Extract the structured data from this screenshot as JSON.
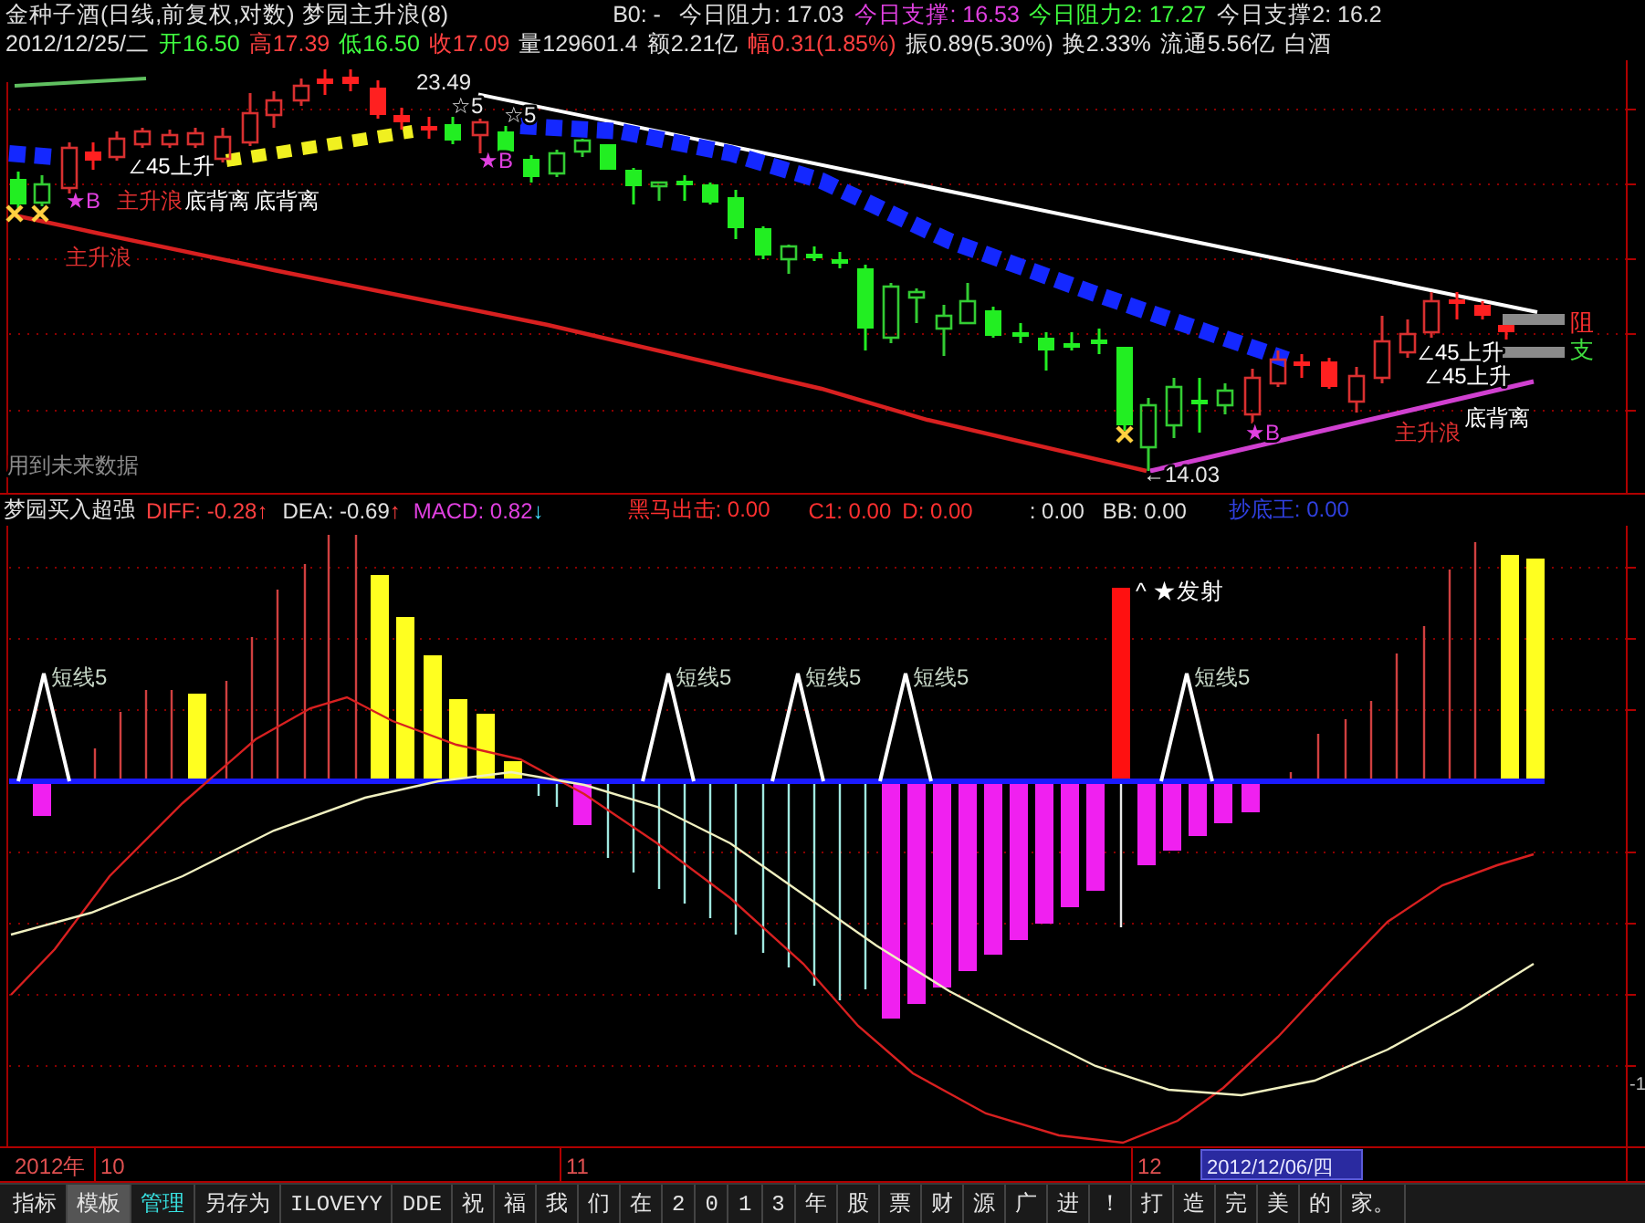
{
  "header": {
    "title": "金种子酒(日线,前复权,对数)",
    "indicator": "梦园主升浪(8)",
    "readouts": [
      {
        "text": "B0: -",
        "color": "#e0e0e0"
      },
      {
        "text": "今日阻力: 17.03",
        "color": "#e0e0e0"
      },
      {
        "text": "今日支撑: 16.53",
        "color": "#e040e0"
      },
      {
        "text": "今日阻力2: 17.27",
        "color": "#40ff40"
      },
      {
        "text": "今日支撑2: 16.2",
        "color": "#e0e0e0"
      }
    ]
  },
  "quote": {
    "date": "2012/12/25/二",
    "fields": [
      {
        "text": "开16.50",
        "color": "#40ff40"
      },
      {
        "text": "高17.39",
        "color": "#ff4040"
      },
      {
        "text": "低16.50",
        "color": "#40ff40"
      },
      {
        "text": "收17.09",
        "color": "#ff4040"
      },
      {
        "text": "量129601.4",
        "color": "#e0e0e0"
      },
      {
        "text": "额2.21亿",
        "color": "#e0e0e0"
      },
      {
        "text": "幅0.31(1.85%)",
        "color": "#ff4040"
      },
      {
        "text": "振0.89(5.30%)",
        "color": "#e0e0e0"
      },
      {
        "text": "换2.33%",
        "color": "#e0e0e0"
      },
      {
        "text": "流通5.56亿",
        "color": "#e0e0e0"
      },
      {
        "text": "白酒",
        "color": "#e0e0e0"
      }
    ]
  },
  "price_chart": {
    "labels": [
      {
        "text": "23.49",
        "kind": "price"
      },
      {
        "text": "☆5",
        "kind": "star"
      },
      {
        "text": "☆5",
        "kind": "star"
      },
      {
        "text": "★B",
        "kind": "buy"
      },
      {
        "text": "∠45上升",
        "kind": "rise"
      },
      {
        "text": "★B",
        "kind": "buy"
      },
      {
        "text": "主升浪",
        "kind": "wave"
      },
      {
        "text": "底背离",
        "kind": "divergence"
      },
      {
        "text": "底背离",
        "kind": "divergence"
      },
      {
        "text": "主升浪",
        "kind": "wave"
      },
      {
        "text": "★B",
        "kind": "buy"
      },
      {
        "text": "←14.03",
        "kind": "price"
      },
      {
        "text": "∠45上升",
        "kind": "rise"
      },
      {
        "text": "∠45上升",
        "kind": "rise"
      },
      {
        "text": "主升浪",
        "kind": "wave"
      },
      {
        "text": "底背离",
        "kind": "divergence"
      },
      {
        "text": "阻",
        "kind": "resistance"
      },
      {
        "text": "支",
        "kind": "support"
      },
      {
        "text": "用到未来数据",
        "kind": "note"
      }
    ]
  },
  "indicator": {
    "title": "梦园买入超强",
    "readouts": [
      {
        "text": "DIFF: -0.28",
        "color": "#ff4040",
        "arrow": {
          "text": "↑",
          "color": "#ff4040"
        }
      },
      {
        "text": "DEA: -0.69",
        "color": "#e0e0e0",
        "arrow": {
          "text": "↑",
          "color": "#ff4040"
        }
      },
      {
        "text": "MACD: 0.82",
        "color": "#e040e0",
        "arrow": {
          "text": "↓",
          "color": "#40e0ff"
        }
      },
      {
        "text": "黑马出击: 0.00",
        "color": "#ff3030"
      },
      {
        "text": "C1: 0.00",
        "color": "#ff3030"
      },
      {
        "text": "D: 0.00",
        "color": "#ff3030"
      },
      {
        "text": ": 0.00",
        "color": "#e0e0e0"
      },
      {
        "text": "BB: 0.00",
        "color": "#e0e0e0"
      },
      {
        "text": "抄底王: 0.00",
        "color": "#3040e0"
      }
    ],
    "labels": [
      {
        "text": "短线5",
        "kind": "short"
      },
      {
        "text": "短线5",
        "kind": "short"
      },
      {
        "text": "短线5",
        "kind": "short"
      },
      {
        "text": "短线5",
        "kind": "short"
      },
      {
        "text": "^ ★发射",
        "kind": "launch"
      },
      {
        "text": "短线5",
        "kind": "short"
      }
    ],
    "axis_label": "-1"
  },
  "date_axis": {
    "year": "2012年",
    "months": [
      "10",
      "11",
      "12"
    ],
    "cursor_date": "2012/12/06/四"
  },
  "toolbar": {
    "tabs": [
      {
        "label": "指标",
        "selected": false,
        "kind": "plain"
      },
      {
        "label": "模板",
        "selected": true,
        "kind": "plain"
      },
      {
        "label": "管理",
        "selected": false,
        "kind": "accent"
      },
      {
        "label": "另存为",
        "selected": false,
        "kind": "plain"
      },
      {
        "label": "ILOVEYY",
        "selected": false,
        "kind": "plain"
      },
      {
        "label": "DDE",
        "selected": false,
        "kind": "plain"
      },
      {
        "label": "祝",
        "selected": false,
        "kind": "plain"
      },
      {
        "label": "福",
        "selected": false,
        "kind": "plain"
      },
      {
        "label": "我",
        "selected": false,
        "kind": "plain"
      },
      {
        "label": "们",
        "selected": false,
        "kind": "plain"
      },
      {
        "label": "在",
        "selected": false,
        "kind": "plain"
      },
      {
        "label": "2",
        "selected": false,
        "kind": "plain"
      },
      {
        "label": "0",
        "selected": false,
        "kind": "plain"
      },
      {
        "label": "1",
        "selected": false,
        "kind": "plain"
      },
      {
        "label": "3",
        "selected": false,
        "kind": "plain"
      },
      {
        "label": "年",
        "selected": false,
        "kind": "plain"
      },
      {
        "label": "股",
        "selected": false,
        "kind": "plain"
      },
      {
        "label": "票",
        "selected": false,
        "kind": "plain"
      },
      {
        "label": "财",
        "selected": false,
        "kind": "plain"
      },
      {
        "label": "源",
        "selected": false,
        "kind": "plain"
      },
      {
        "label": "广",
        "selected": false,
        "kind": "plain"
      },
      {
        "label": "进",
        "selected": false,
        "kind": "plain"
      },
      {
        "label": "！",
        "selected": false,
        "kind": "plain"
      },
      {
        "label": "打",
        "selected": false,
        "kind": "plain"
      },
      {
        "label": "造",
        "selected": false,
        "kind": "plain"
      },
      {
        "label": "完",
        "selected": false,
        "kind": "plain"
      },
      {
        "label": "美",
        "selected": false,
        "kind": "plain"
      },
      {
        "label": "的",
        "selected": false,
        "kind": "plain"
      },
      {
        "label": "家。",
        "selected": false,
        "kind": "plain"
      }
    ]
  }
}
